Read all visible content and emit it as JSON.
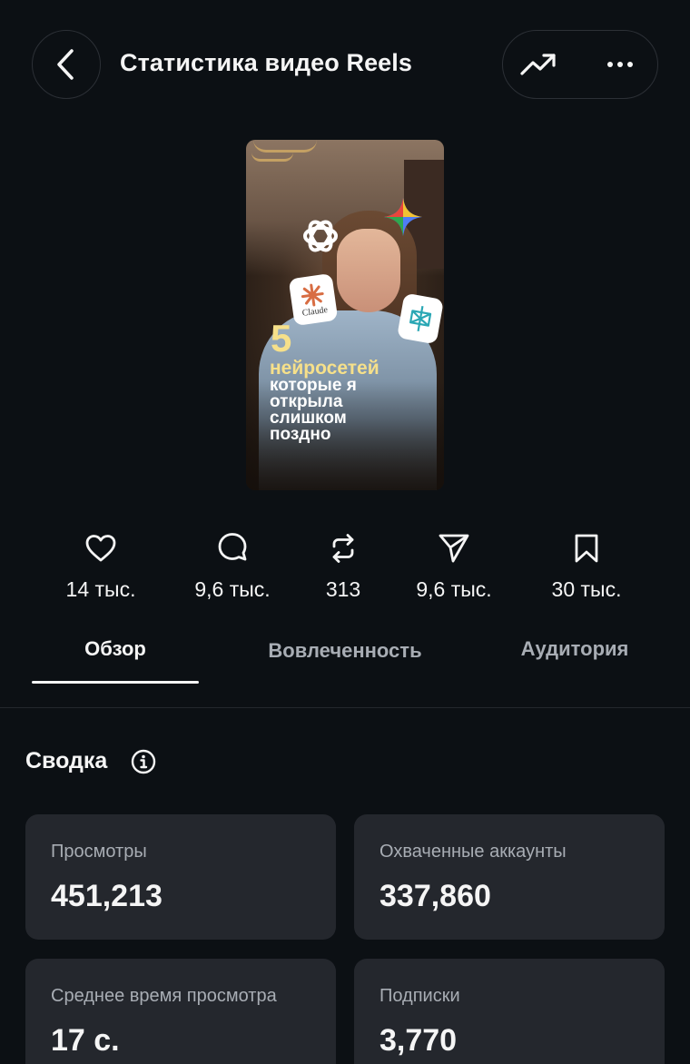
{
  "header": {
    "title": "Статистика видео Reels",
    "back_icon": "chevron-left-icon",
    "insights_icon": "trending-up-icon",
    "more_icon": "more-horizontal-icon"
  },
  "thumbnail": {
    "number": "5",
    "line1": "нейросетей",
    "line2": "которые я",
    "line3": "открыла",
    "line4": "слишком",
    "line5": "поздно",
    "logo_label": "Claude"
  },
  "stats": [
    {
      "icon": "heart-icon",
      "value": "14 тыс."
    },
    {
      "icon": "comment-icon",
      "value": "9,6 тыс."
    },
    {
      "icon": "repost-icon",
      "value": "313"
    },
    {
      "icon": "share-icon",
      "value": "9,6 тыс."
    },
    {
      "icon": "bookmark-icon",
      "value": "30 тыс."
    }
  ],
  "tabs": [
    {
      "label": "Обзор",
      "active": true
    },
    {
      "label": "Вовлеченность",
      "active": false
    },
    {
      "label": "Аудитория",
      "active": false
    }
  ],
  "summary": {
    "title": "Сводка",
    "cards": [
      {
        "label": "Просмотры",
        "value": "451,213"
      },
      {
        "label": "Охваченные аккаунты",
        "value": "337,860"
      },
      {
        "label": "Среднее время просмотра",
        "value": "17 с."
      },
      {
        "label": "Подписки",
        "value": "3,770"
      }
    ]
  },
  "colors": {
    "background": "#0c1014",
    "card": "#24272d",
    "text_primary": "#f5f5f5",
    "text_secondary": "#a8adb4",
    "accent_yellow": "#f6e08a"
  }
}
